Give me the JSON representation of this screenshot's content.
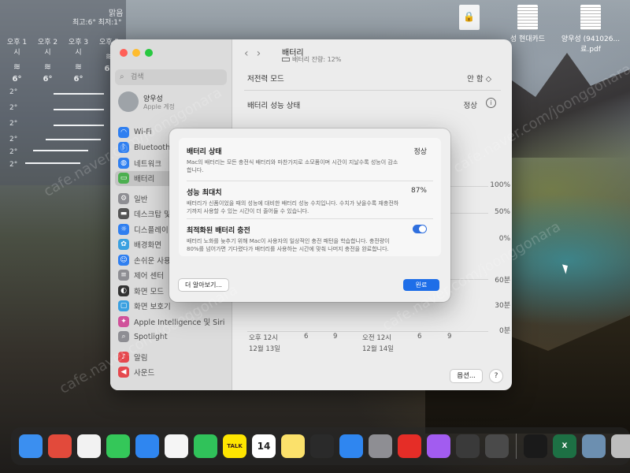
{
  "weather": {
    "condition": "맑음",
    "hilo": "최고:6° 최저:1°",
    "hours": [
      {
        "time": "오후 1시",
        "temp": "6°"
      },
      {
        "time": "오후 2시",
        "temp": "6°"
      },
      {
        "time": "오후 3시",
        "temp": "6°"
      },
      {
        "time": "오후 5",
        "temp": "6°"
      }
    ],
    "graph_labels": [
      "2°",
      "2°",
      "2°",
      "2°",
      "2°",
      "2°"
    ]
  },
  "desktop_files": [
    {
      "name": ""
    },
    {
      "name": "성 현대카드"
    },
    {
      "name": "양우성 (941026...료.pdf"
    }
  ],
  "sidebar": {
    "search_placeholder": "검색",
    "account_name": "양우성",
    "account_sub": "Apple 계정",
    "items": [
      {
        "label": "Wi-Fi",
        "color": "#2f7ff0",
        "icon": "wifi-icon"
      },
      {
        "label": "Bluetooth",
        "color": "#2f7ff0",
        "icon": "bluetooth-icon"
      },
      {
        "label": "네트워크",
        "color": "#2f7ff0",
        "icon": "globe-icon"
      },
      {
        "label": "배터리",
        "color": "#4caf50",
        "icon": "battery-icon"
      },
      {
        "label": "일반",
        "color": "#8e8e93",
        "icon": "gear-icon"
      },
      {
        "label": "데스크탑 및 Dock",
        "color": "#555",
        "icon": "dock-icon"
      },
      {
        "label": "디스플레이",
        "color": "#2f7ff0",
        "icon": "sun-icon"
      },
      {
        "label": "배경화면",
        "color": "#3aa0e0",
        "icon": "flower-icon"
      },
      {
        "label": "손쉬운 사용",
        "color": "#2f7ff0",
        "icon": "accessibility-icon"
      },
      {
        "label": "제어 센터",
        "color": "#8e8e93",
        "icon": "toggles-icon"
      },
      {
        "label": "화면 모드",
        "color": "#333",
        "icon": "contrast-icon"
      },
      {
        "label": "화면 보호기",
        "color": "#3aa0e0",
        "icon": "screensaver-icon"
      },
      {
        "label": "Apple Intelligence 및 Siri",
        "color": "#d0529a",
        "icon": "siri-icon"
      },
      {
        "label": "Spotlight",
        "color": "#8e8e93",
        "icon": "search-icon"
      },
      {
        "label": "알림",
        "color": "#e5484d",
        "icon": "bell-icon"
      },
      {
        "label": "사운드",
        "color": "#e5484d",
        "icon": "speaker-icon"
      }
    ]
  },
  "main": {
    "title": "배터리",
    "subtitle": "배터리 잔량: 12%",
    "low_power_label": "저전력 모드",
    "low_power_value": "안 함 ◇",
    "health_label": "배터리 성능 상태",
    "health_value": "정상",
    "chart_right_labels": [
      "100%",
      "50%",
      "0%",
      "60분",
      "30분",
      "0분"
    ],
    "chart_x_labels": [
      "오후 12시",
      "6",
      "9",
      "오전 12시",
      "6",
      "9"
    ],
    "chart_dates": [
      "12월 13일",
      "12월 14일"
    ],
    "options_label": "옵션...",
    "help_label": "?"
  },
  "dialog": {
    "status_title": "배터리 상태",
    "status_value": "정상",
    "status_desc": "Mac의 배터리는 모든 충전식 배터리와 마찬가지로 소모품이며 시간이 지날수록 성능이 감소합니다.",
    "capacity_title": "성능 최대치",
    "capacity_value": "87%",
    "capacity_desc": "배터리가 신품이었을 때의 성능에 대비한 배터리 성능 수치입니다. 수치가 낮을수록 재충전하기까지 사용할 수 있는 시간이 더 줄어들 수 있습니다.",
    "optimized_title": "최적화된 배터리 충전",
    "optimized_desc": "배터리 노화를 늦추기 위해 Mac이 사용자의 일상적인 충전 패턴을 학습합니다. 충전량이 80%를 넘어가면 기다렸다가 배터리를 사용하는 시간에 맞춰 나머지 충전을 완료합니다.",
    "learn_more": "더 알아보기...",
    "done": "완료"
  },
  "dock": {
    "apps": [
      {
        "name": "finder",
        "color": "#3b8ff0",
        "label": ""
      },
      {
        "name": "launchpad",
        "color": "#e24a3b",
        "label": ""
      },
      {
        "name": "chrome",
        "color": "#f2f2f2",
        "label": ""
      },
      {
        "name": "messages",
        "color": "#34c759",
        "label": ""
      },
      {
        "name": "mail",
        "color": "#2f86f0",
        "label": ""
      },
      {
        "name": "photos",
        "color": "#f5f5f5",
        "label": ""
      },
      {
        "name": "facetime",
        "color": "#30c25a",
        "label": ""
      },
      {
        "name": "kakaotalk",
        "color": "#fee500",
        "label": "TALK"
      },
      {
        "name": "calendar",
        "color": "#ffffff",
        "label": "14"
      },
      {
        "name": "notes",
        "color": "#fbe16b",
        "label": ""
      },
      {
        "name": "finalcut",
        "color": "#2a2a2a",
        "label": ""
      },
      {
        "name": "appstore",
        "color": "#2f86f0",
        "label": ""
      },
      {
        "name": "settings",
        "color": "#8e8e93",
        "label": ""
      },
      {
        "name": "youtube-music",
        "color": "#e52d27",
        "label": ""
      },
      {
        "name": "podcast",
        "color": "#a25cf0",
        "label": ""
      },
      {
        "name": "calculator",
        "color": "#3a3a3a",
        "label": ""
      },
      {
        "name": "iphone-mirror",
        "color": "#4a4a4a",
        "label": ""
      },
      {
        "name": "capcut",
        "color": "#1a1a1a",
        "label": ""
      },
      {
        "name": "excel",
        "color": "#1d7044",
        "label": "X"
      },
      {
        "name": "preview",
        "color": "#6c8fb0",
        "label": ""
      },
      {
        "name": "trash",
        "color": "#bdbdbd",
        "label": ""
      }
    ]
  },
  "watermark": "cafe.naver.com/joonggonara"
}
